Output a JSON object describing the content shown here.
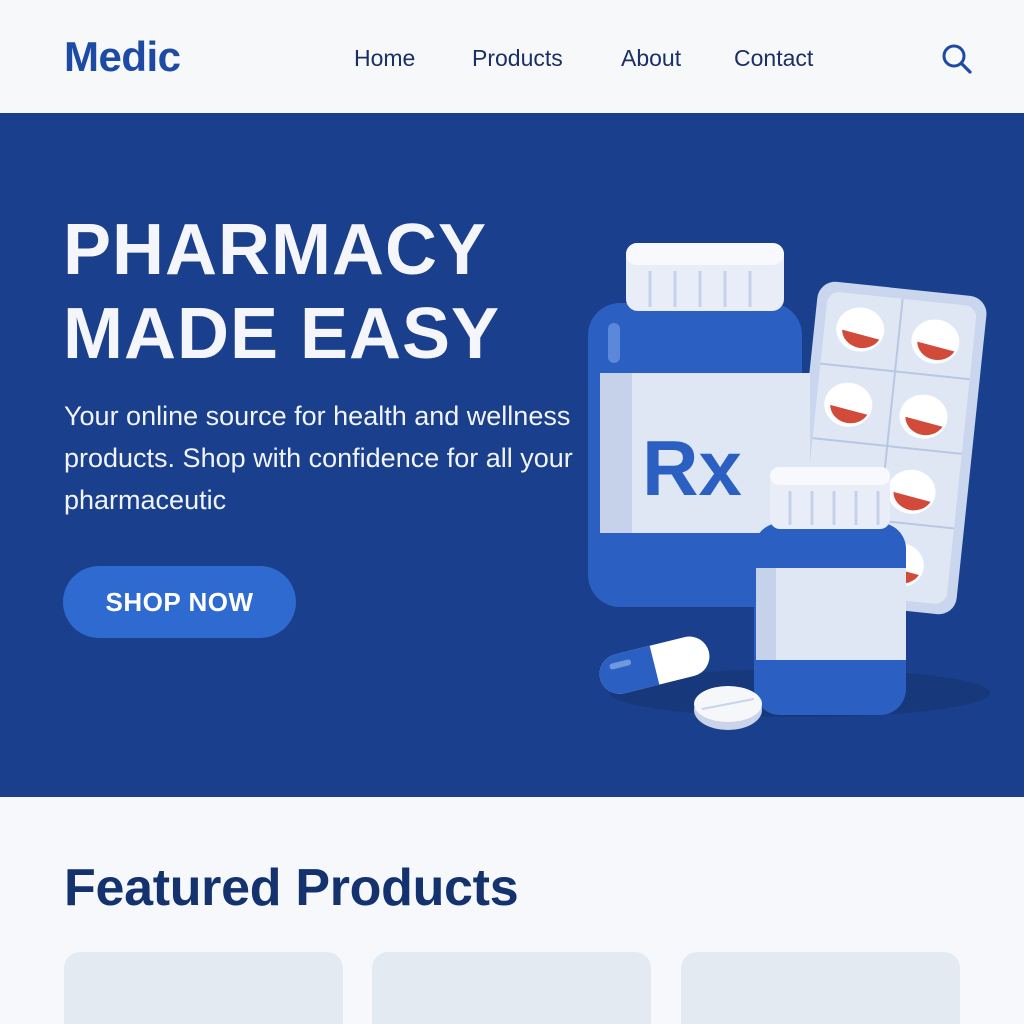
{
  "brand": {
    "name": "Medic"
  },
  "nav": {
    "items": [
      {
        "label": "Home"
      },
      {
        "label": "Products"
      },
      {
        "label": "About"
      },
      {
        "label": "Contact"
      }
    ],
    "search_icon": "search-icon"
  },
  "hero": {
    "title_line1": "PHARMACY",
    "title_line2": "MADE EASY",
    "description": "Your online source for health and wellness products. Shop with confidence for all your pharmaceutic",
    "cta_label": "SHOP NOW",
    "illustration_label": "Rx"
  },
  "featured": {
    "title": "Featured Products",
    "cards": [
      {},
      {},
      {}
    ]
  },
  "colors": {
    "brand": "#1c4aa5",
    "hero_bg": "#1a3f8c",
    "cta": "#2f6ad0",
    "page_bg": "#f6f8fb",
    "card_bg": "#e4eaf2"
  }
}
